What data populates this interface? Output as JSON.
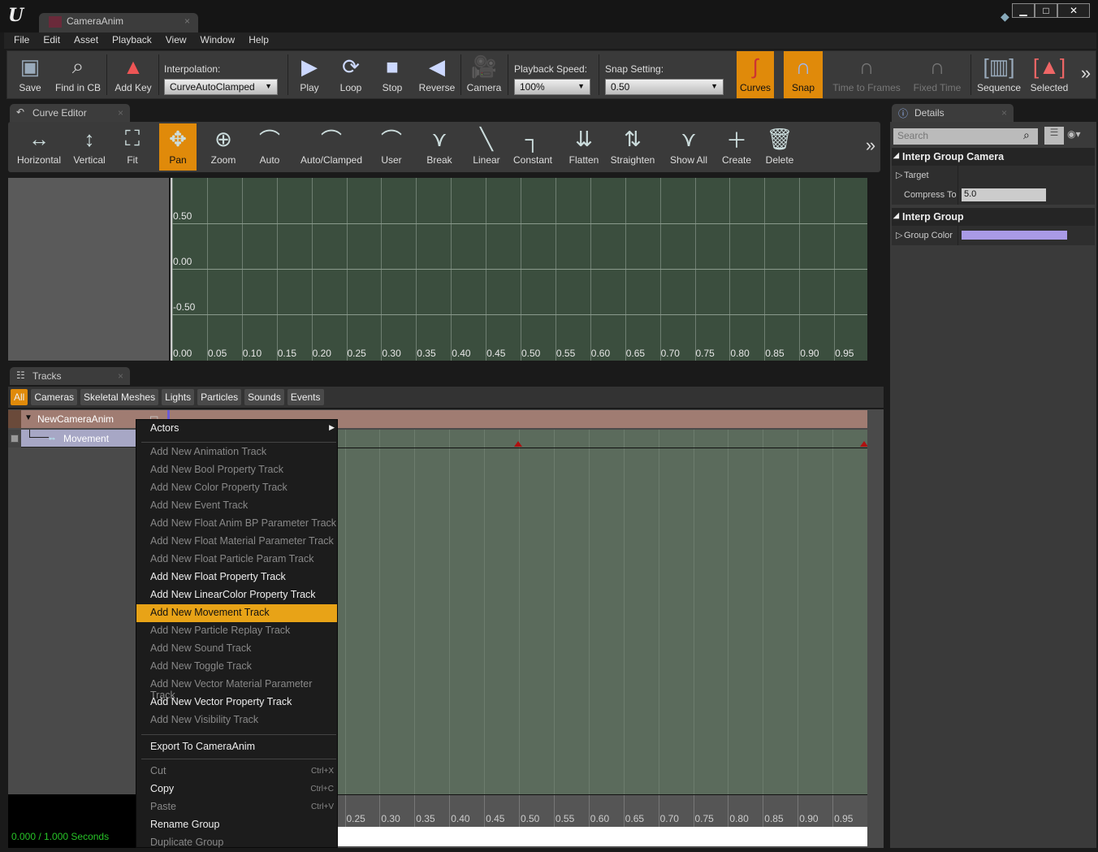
{
  "window": {
    "doc_tab": "CameraAnim",
    "doc_tab_close": "×",
    "controls": [
      "▁",
      "□",
      "✕"
    ]
  },
  "menubar": [
    "File",
    "Edit",
    "Asset",
    "Playback",
    "View",
    "Window",
    "Help"
  ],
  "toolbar": {
    "save": "Save",
    "find": "Find in CB",
    "add_key": "Add Key",
    "interpolation_label": "Interpolation:",
    "interpolation_value": "CurveAutoClamped",
    "play": "Play",
    "loop": "Loop",
    "stop": "Stop",
    "reverse": "Reverse",
    "camera": "Camera",
    "playback_speed_label": "Playback Speed:",
    "playback_speed_value": "100%",
    "snap_setting_label": "Snap Setting:",
    "snap_setting_value": "0.50",
    "curves": "Curves",
    "snap": "Snap",
    "time_to_frames": "Time to Frames",
    "fixed_time": "Fixed Time",
    "sequence": "Sequence",
    "selected": "Selected",
    "more": "»"
  },
  "curve_editor": {
    "tab": "Curve Editor",
    "close": "×",
    "tools": [
      "Horizontal",
      "Vertical",
      "Fit",
      "Pan",
      "Zoom",
      "Auto",
      "Auto/Clamped",
      "User",
      "Break",
      "Linear",
      "Constant",
      "Flatten",
      "Straighten",
      "Show All",
      "Create",
      "Delete"
    ],
    "active_tool": "Pan",
    "more": "»",
    "y_labels": [
      "0.50",
      "0.00",
      "-0.50"
    ],
    "x_labels": [
      "0.00",
      "0.05",
      "0.10",
      "0.15",
      "0.20",
      "0.25",
      "0.30",
      "0.35",
      "0.40",
      "0.45",
      "0.50",
      "0.55",
      "0.60",
      "0.65",
      "0.70",
      "0.75",
      "0.80",
      "0.85",
      "0.90",
      "0.95"
    ]
  },
  "tracks": {
    "tab": "Tracks",
    "close": "×",
    "filters": [
      "All",
      "Cameras",
      "Skeletal Meshes",
      "Lights",
      "Particles",
      "Sounds",
      "Events"
    ],
    "active_filter": "All",
    "group": "NewCameraAnim",
    "track": "Movement",
    "ruler_labels": [
      "0.25",
      "0.30",
      "0.35",
      "0.40",
      "0.45",
      "0.50",
      "0.55",
      "0.60",
      "0.65",
      "0.70",
      "0.75",
      "0.80",
      "0.85",
      "0.90",
      "0.95"
    ],
    "time_readout": "0.000 / 1.000 Seconds"
  },
  "context_menu": {
    "actors": "Actors",
    "items": [
      {
        "label": "Add New Animation Track",
        "enabled": false
      },
      {
        "label": "Add New Bool Property Track",
        "enabled": false
      },
      {
        "label": "Add New Color Property Track",
        "enabled": false
      },
      {
        "label": "Add New Event Track",
        "enabled": false
      },
      {
        "label": "Add New Float Anim BP Parameter Track",
        "enabled": false
      },
      {
        "label": "Add New Float Material Parameter Track",
        "enabled": false
      },
      {
        "label": "Add New Float Particle Param Track",
        "enabled": false
      },
      {
        "label": "Add New Float Property Track",
        "enabled": true
      },
      {
        "label": "Add New LinearColor Property Track",
        "enabled": true
      },
      {
        "label": "Add New Movement Track",
        "enabled": true,
        "highlighted": true
      },
      {
        "label": "Add New Particle Replay Track",
        "enabled": false
      },
      {
        "label": "Add New Sound Track",
        "enabled": false
      },
      {
        "label": "Add New Toggle Track",
        "enabled": false
      },
      {
        "label": "Add New Vector Material Parameter Track",
        "enabled": false
      },
      {
        "label": "Add New Vector Property Track",
        "enabled": true
      },
      {
        "label": "Add New Visibility Track",
        "enabled": false
      }
    ],
    "export": "Export To CameraAnim",
    "edit": [
      {
        "label": "Cut",
        "shortcut": "Ctrl+X",
        "enabled": false
      },
      {
        "label": "Copy",
        "shortcut": "Ctrl+C",
        "enabled": true
      },
      {
        "label": "Paste",
        "shortcut": "Ctrl+V",
        "enabled": false
      },
      {
        "label": "Rename Group",
        "shortcut": "",
        "enabled": true
      },
      {
        "label": "Duplicate Group",
        "shortcut": "",
        "enabled": false
      }
    ]
  },
  "details": {
    "tab": "Details",
    "close": "×",
    "search_placeholder": "Search",
    "section1": "Interp Group Camera",
    "target": "Target",
    "compress_label": "Compress To",
    "compress_value": "5.0",
    "section2": "Interp Group",
    "group_color_label": "Group Color",
    "group_color": "#a99ae6"
  },
  "colors": {
    "accent": "#e08a0a",
    "menu_highlight": "#e8a317",
    "time_readout": "#27c427"
  }
}
